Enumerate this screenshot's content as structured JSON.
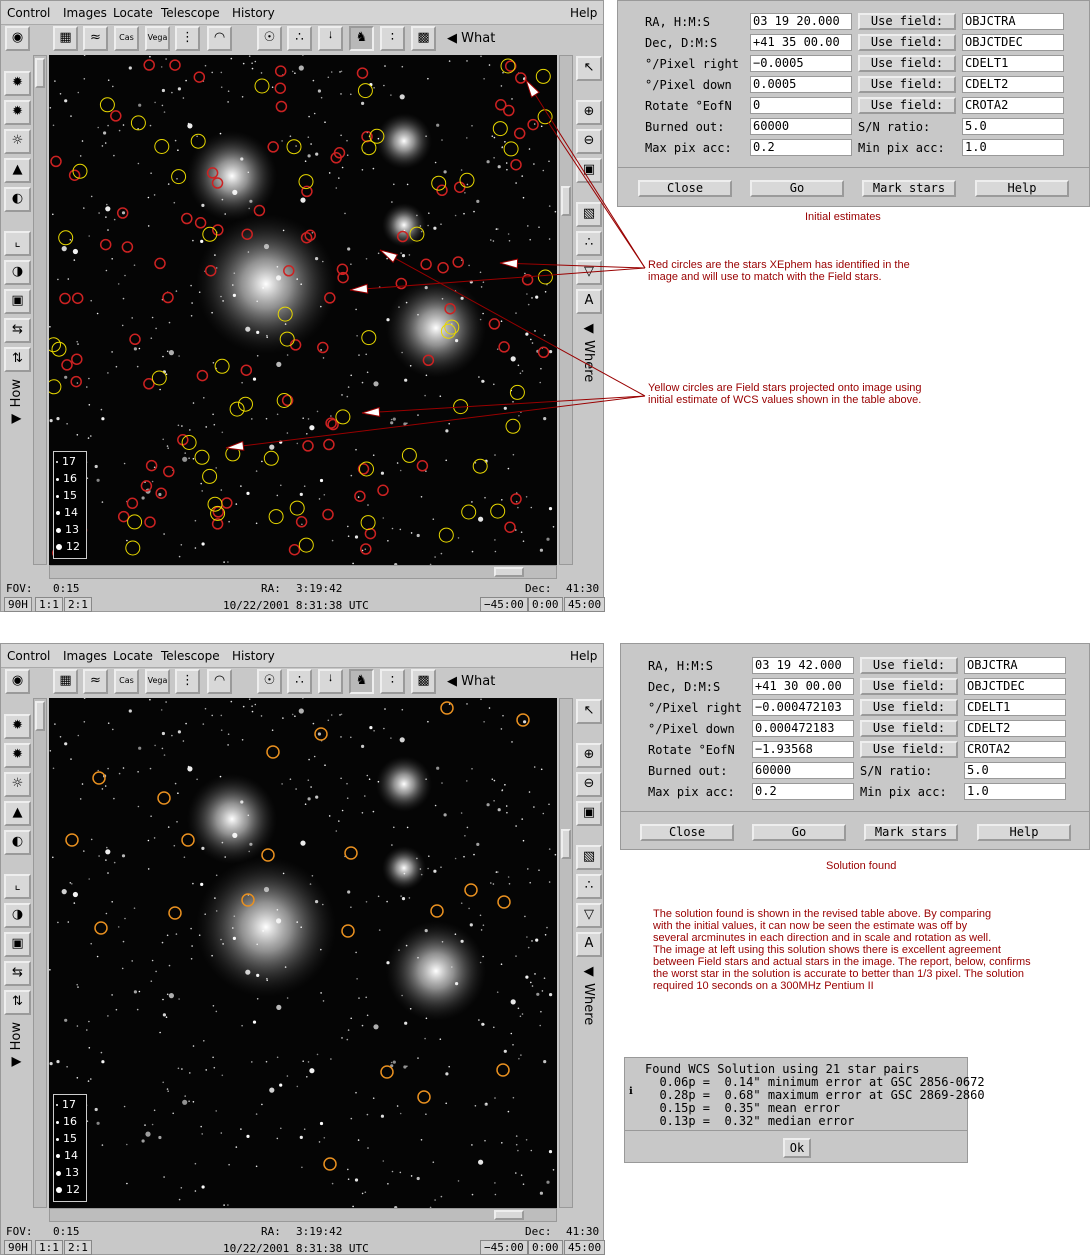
{
  "menu": {
    "control": "Control",
    "images": "Images",
    "locate": "Locate",
    "telescope": "Telescope",
    "history": "History",
    "help": "Help"
  },
  "toolbar": {
    "what_label": "What",
    "vega_label": "Vega",
    "cas_label": "Cas"
  },
  "side": {
    "how_label": "How",
    "where_label": "Where"
  },
  "legend": [
    "17",
    "16",
    "15",
    "14",
    "13",
    "12"
  ],
  "status": {
    "fov_label": "FOV:",
    "fov_value": "0:15",
    "ra_label": "RA:",
    "ra_value": "3:19:42",
    "dec_label": "Dec:",
    "dec_value": "41:30",
    "zoom_90h": "90H",
    "zoom_1": "1:1",
    "zoom_2": "2:1",
    "datetime": "10/22/2001   8:31:38 UTC",
    "rot_neg": "−45:00",
    "rot_zero": "0:00",
    "rot_pos": "45:00"
  },
  "dialog_labels": {
    "ra": "RA, H:M:S",
    "dec": "Dec, D:M:S",
    "pix_right": "°/Pixel right",
    "pix_down": "°/Pixel down",
    "rotate": "Rotate °EofN",
    "burned": "Burned out:",
    "maxpix": "Max pix acc:",
    "use_field": "Use field:",
    "snratio": "S/N ratio:",
    "minpix": "Min pix acc:",
    "close": "Close",
    "go": "Go",
    "mark": "Mark stars",
    "help": "Help"
  },
  "dialog1": {
    "ra": "03 19 20.000",
    "dec": "+41 35 00.00",
    "pix_right": "−0.0005",
    "pix_down": "0.0005",
    "rotate": "0",
    "burned": "60000",
    "maxpix": "0.2",
    "field_ra": "OBJCTRA",
    "field_dec": "OBJCTDEC",
    "field_cd1": "CDELT1",
    "field_cd2": "CDELT2",
    "field_rot": "CROTA2",
    "snratio": "5.0",
    "minpix": "1.0"
  },
  "dialog2": {
    "ra": "03 19 42.000",
    "dec": "+41 30 00.00",
    "pix_right": "−0.000472103",
    "pix_down": "0.000472183",
    "rotate": "−1.93568",
    "burned": "60000",
    "maxpix": "0.2",
    "field_ra": "OBJCTRA",
    "field_dec": "OBJCTDEC",
    "field_cd1": "CDELT1",
    "field_cd2": "CDELT2",
    "field_rot": "CROTA2",
    "snratio": "5.0",
    "minpix": "1.0"
  },
  "captions": {
    "initial": "Initial estimates",
    "solution": "Solution found",
    "red_note": [
      "Red circles are the stars XEphem has identified in the",
      "image and will use to match with the Field stars."
    ],
    "yellow_note": [
      "Yellow circles are Field stars projected onto image using",
      "initial estimate of WCS values shown in the table above."
    ],
    "solution_note": [
      "The solution found is shown in the revised table above. By comparing",
      "with the initial values, it can now be seen the estimate was off by",
      "several arcminutes in each direction and in scale and rotation as well.",
      "The image at left using this solution shows there is excellent agreement",
      "between Field stars and actual stars in the image. The report, below, confirms",
      "the worst star in the solution is accurate to better than 1/3 pixel. The solution",
      "required 10 seconds on a 300MHz Pentium II"
    ]
  },
  "report": {
    "lines": [
      "Found WCS Solution using 21 star pairs",
      "  0.06p =  0.14\" minimum error at GSC 2856-0672",
      "  0.28p =  0.68\" maximum error at GSC 2869-2860",
      "  0.15p =  0.35\" mean error",
      "  0.13p =  0.32\" median error"
    ],
    "ok": "Ok"
  },
  "colors": {
    "red_circle": "#cc2222",
    "yellow_circle": "#e8d800",
    "orange_circle": "#e89020",
    "annotation": "#990000"
  }
}
